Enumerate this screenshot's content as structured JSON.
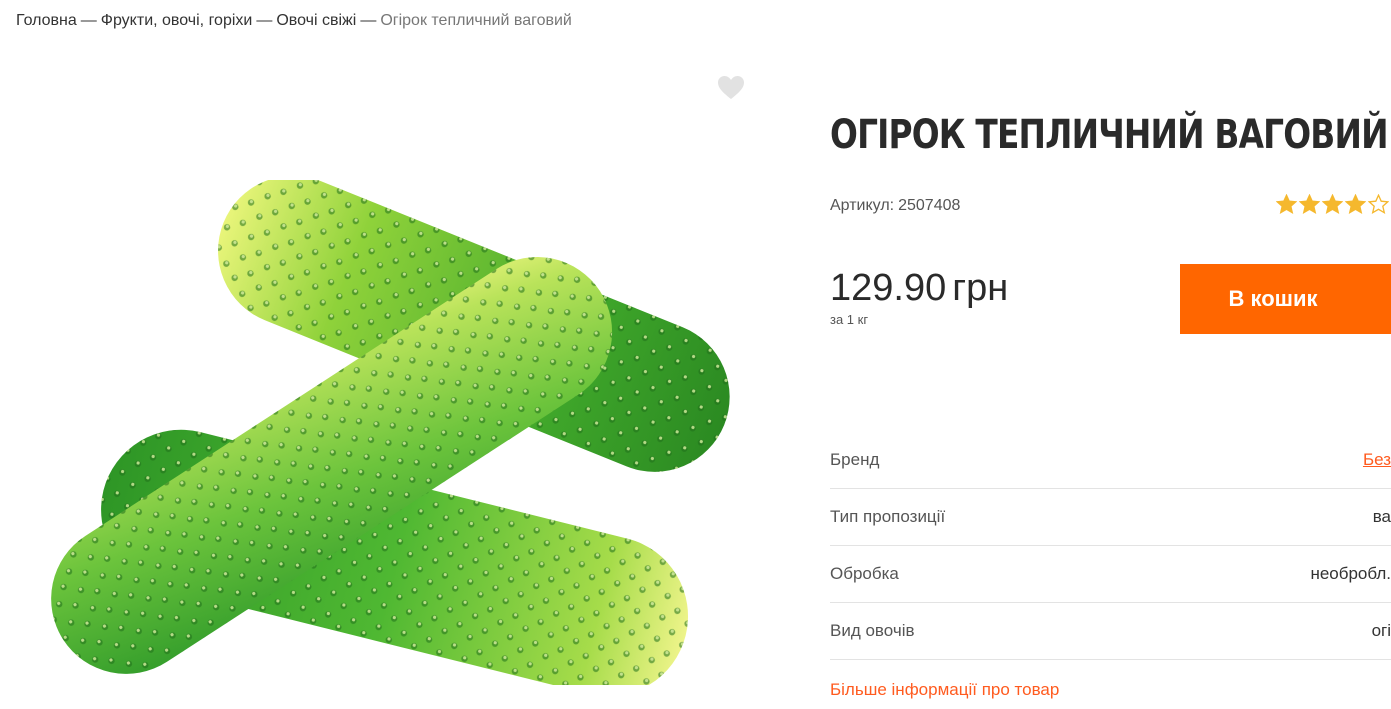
{
  "breadcrumb": {
    "items": [
      "Головна",
      "Фрукти, овочі, горіхи",
      "Овочі свіжі"
    ],
    "separator": "—",
    "current": "Огірок тепличний ваговий"
  },
  "product": {
    "title": "Огірок тепличний ваговий",
    "sku_label": "Артикул:",
    "sku": "2507408",
    "rating": 4,
    "rating_max": 5,
    "price": "129.90",
    "currency": "грн",
    "unit": "за 1 кг",
    "add_to_cart": "В кошик"
  },
  "specs": [
    {
      "key": "Бренд",
      "value": "Без",
      "is_link": true
    },
    {
      "key": "Тип пропозиції",
      "value": "ва",
      "is_link": false
    },
    {
      "key": "Обробка",
      "value": "необробл.",
      "is_link": false
    },
    {
      "key": "Вид овочів",
      "value": "огі",
      "is_link": false
    }
  ],
  "more_info": "Більше інформації про товар",
  "icons": {
    "favorite": "heart-icon",
    "rating": "star-icon"
  },
  "colors": {
    "accent": "#ff6600",
    "link": "#ff5b1f",
    "star": "#f5b82e",
    "heart": "#e2e2e2"
  }
}
